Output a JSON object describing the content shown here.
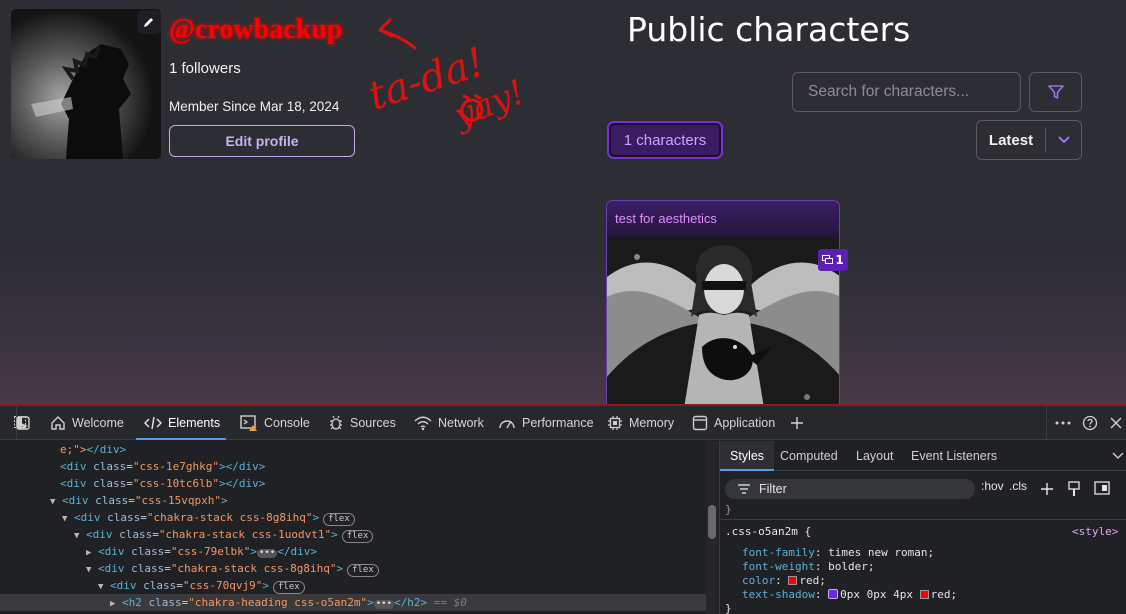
{
  "profile": {
    "username": "@crowbackup",
    "followers": "1 followers",
    "member_since": "Member Since Mar 18, 2024",
    "edit_profile_label": "Edit profile"
  },
  "scribble": {
    "line1": "ta-da!",
    "line2": "yay!"
  },
  "characters": {
    "title": "Public characters",
    "search_placeholder": "Search for characters...",
    "count_label": "1 characters",
    "sort_label": "Latest",
    "cards": [
      {
        "name": "test for aesthetics",
        "badge_count": "1"
      }
    ]
  },
  "devtools": {
    "tabs": [
      "Welcome",
      "Elements",
      "Console",
      "Sources",
      "Network",
      "Performance",
      "Memory",
      "Application"
    ],
    "active_tab": "Elements",
    "dom_lines": [
      {
        "indent": 0,
        "text_pre": "e;\">",
        "tag": "</div>"
      },
      {
        "indent": 0,
        "open": "<div",
        "attr": "class",
        "val": "\"css-1e7ghkg\"",
        "close": "></div>"
      },
      {
        "indent": 0,
        "open": "<div",
        "attr": "class",
        "val": "\"css-10tc6lb\"",
        "close": "></div>"
      },
      {
        "indent": 0,
        "open": "<div",
        "attr": "class",
        "val": "\"css-15vqpxh\"",
        "close": ">"
      },
      {
        "indent": 1,
        "open": "<div",
        "attr": "class",
        "val": "\"chakra-stack css-8g8ihq\"",
        "close": ">",
        "chip": "flex"
      },
      {
        "indent": 2,
        "open": "<div",
        "attr": "class",
        "val": "\"chakra-stack css-1uodvt1\"",
        "close": ">",
        "chip": "flex"
      },
      {
        "indent": 3,
        "open": "<div",
        "attr": "class",
        "val": "\"css-79elbk\"",
        "close": "></div>"
      },
      {
        "indent": 3,
        "open": "<div",
        "attr": "class",
        "val": "\"chakra-stack css-8g8ihq\"",
        "close": ">",
        "chip": "flex"
      },
      {
        "indent": 4,
        "open": "<div",
        "attr": "class",
        "val": "\"css-70qvj9\"",
        "close": ">",
        "chip": "flex"
      },
      {
        "indent": 5,
        "open": "<h2",
        "attr": "class",
        "val": "\"chakra-heading css-o5an2m\"",
        "close": "></h2>",
        "eq": "== $0"
      }
    ],
    "styles_tabs": [
      "Styles",
      "Computed",
      "Layout",
      "Event Listeners"
    ],
    "filter_label": "Filter",
    "hov_label": ":hov",
    "cls_label": ".cls",
    "rule": {
      "selector": ".css-o5an2m {",
      "source": "<style>",
      "decls": [
        {
          "prop": "font-family",
          "value": "times new roman;"
        },
        {
          "prop": "font-weight",
          "value": "bolder;"
        },
        {
          "prop": "color",
          "value": "red;"
        },
        {
          "prop": "text-shadow",
          "value": "0px 0px 4px",
          "value2": "red;"
        }
      ],
      "close": "}"
    },
    "prev_close": "}"
  },
  "colors": {
    "accent": "#7b2ee0",
    "username": "#ff0000",
    "devtools_border": "#8b1a1a"
  }
}
